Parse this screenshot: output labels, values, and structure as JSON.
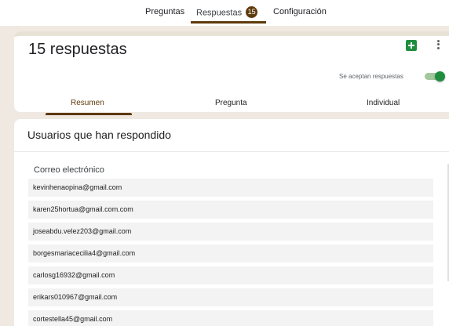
{
  "tabs": {
    "preguntas": "Preguntas",
    "respuestas": "Respuestas",
    "respuestas_count": "15",
    "configuracion": "Configuración"
  },
  "summary": {
    "title": "15 respuestas",
    "accepting_label": "Se aceptan respuestas",
    "accepting": true
  },
  "views": {
    "resumen": "Resumen",
    "pregunta": "Pregunta",
    "individual": "Individual"
  },
  "respondents": {
    "title": "Usuarios que han respondido",
    "column": "Correo electrónico",
    "emails": [
      "kevinhenaopina@gmail.com",
      "karen25hortua@gmail.com.com",
      "joseabdu.velez203@gmail.com",
      "borgesmariacecilia4@gmail.com",
      "carlosg16932@gmail.com",
      "erikars010967@gmail.com",
      "cortestella45@gmail.com"
    ]
  },
  "colors": {
    "accent": "#5e3a0c",
    "sheets_green": "#1e8e3e",
    "background": "#efe9e1"
  },
  "icons": {
    "sheets": "sheets-icon",
    "more": "more-vert-icon"
  }
}
